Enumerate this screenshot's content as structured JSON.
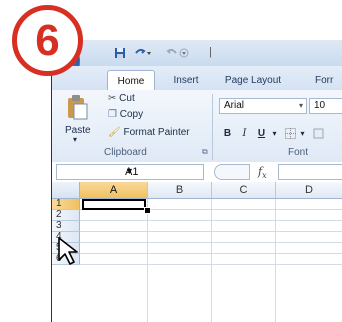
{
  "step_number": "6",
  "colors": {
    "badge": "#d72f22",
    "ribbon": "#dfe9f6",
    "selected_header": "#f1c15e"
  },
  "qat": {
    "save_icon": "save-icon",
    "undo_icon": "undo-icon",
    "redo_icon": "redo-icon",
    "separator": "|"
  },
  "tabs": [
    "Home",
    "Insert",
    "Page Layout",
    "Forr"
  ],
  "ribbon": {
    "clipboard": {
      "cut": "Cut",
      "copy": "Copy",
      "paste": "Paste",
      "format_painter": "Format Painter",
      "group_label": "Clipboard"
    },
    "font": {
      "font_name": "Arial",
      "font_size": "10",
      "bold": "B",
      "italic": "I",
      "underline": "U",
      "group_label": "Font"
    }
  },
  "formula_bar": {
    "name_box": "A1",
    "fx": "fx",
    "formula": ""
  },
  "sheet": {
    "columns": [
      "A",
      "B",
      "C",
      "D"
    ],
    "rows": [
      "1",
      "2",
      "3",
      "4",
      "5",
      "6"
    ],
    "active_cell": "A1"
  }
}
